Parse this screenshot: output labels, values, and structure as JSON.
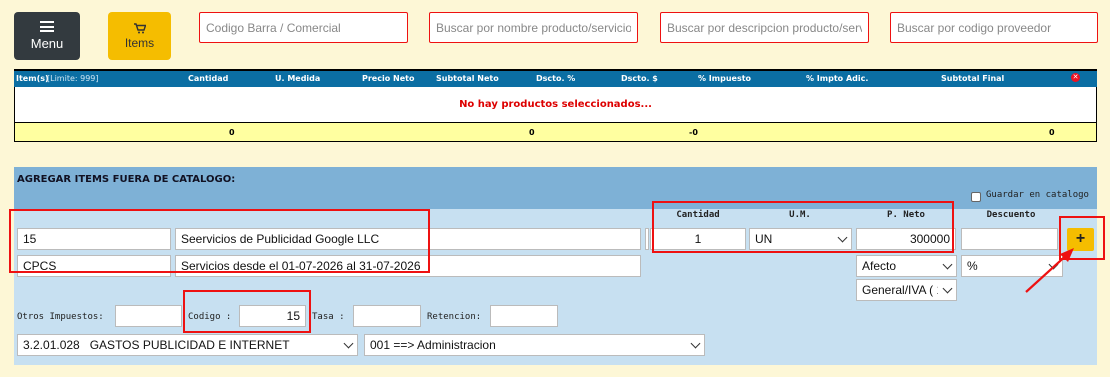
{
  "toolbar": {
    "menu_label": "Menu",
    "items_label": "Items"
  },
  "search": {
    "barcode_placeholder": "Codigo Barra / Comercial",
    "name_placeholder": "Buscar por nombre producto/servicio",
    "description_placeholder": "Buscar por descripcion producto/servicio",
    "supplier_placeholder": "Buscar por codigo proveedor"
  },
  "items_table": {
    "columns": {
      "items": "Item(s)",
      "limit": "[Limite: 999]",
      "cantidad": "Cantidad",
      "u_medida": "U. Medida",
      "precio_neto": "Precio Neto",
      "subtotal_neto": "Subtotal Neto",
      "dscto_pct": "Dscto. %",
      "dscto_amt": "Dscto. $",
      "impuesto": "% Impuesto",
      "impto_adic": "% Impto Adic.",
      "subtotal_final": "Subtotal Final"
    },
    "empty_message": "No hay productos seleccionados...",
    "totals": {
      "cantidad": "0",
      "subtotal_neto": "0",
      "impuesto": "-0",
      "subtotal_final": "0"
    }
  },
  "outside_catalog": {
    "title": "AGREGAR ITEMS FUERA DE CATALOGO:",
    "save_in_catalog_label": "Guardar en catalogo",
    "save_in_catalog_checked": false,
    "headers": {
      "cantidad": "Cantidad",
      "um": "U.M.",
      "p_neto": "P. Neto",
      "descuento": "Descuento"
    },
    "code_value": "15",
    "name_value": "Seervicios de Publicidad Google LLC",
    "sub_code_value": "CPCS",
    "description_value": "Servicios desde el 01-07-2026 al 31-07-2026",
    "cantidad_value": "1",
    "um_value": "UN",
    "p_neto_value": "300000",
    "descuento_value": "",
    "afecto_value": "Afecto",
    "tax_value": "General/IVA ( 1",
    "discount_type_value": "%",
    "add_button_label": "+",
    "otros_impuestos_label": "Otros Impuestos:",
    "otros_impuestos_value": "",
    "codigo_label": "Codigo :",
    "codigo_value": "15",
    "tasa_label": "Tasa :",
    "tasa_value": "",
    "retencion_label": "Retencion:",
    "retencion_value": "",
    "account_value": "3.2.01.028   GASTOS PUBLICIDAD E INTERNET",
    "cost_center_value": "001 ==> Administracion"
  },
  "colors": {
    "background": "#fdf7d6",
    "header_blue": "#0b6ea3",
    "accent_yellow": "#f5bd00",
    "highlight_red": "#ee1111",
    "panel_blue": "#c7e0f1"
  }
}
